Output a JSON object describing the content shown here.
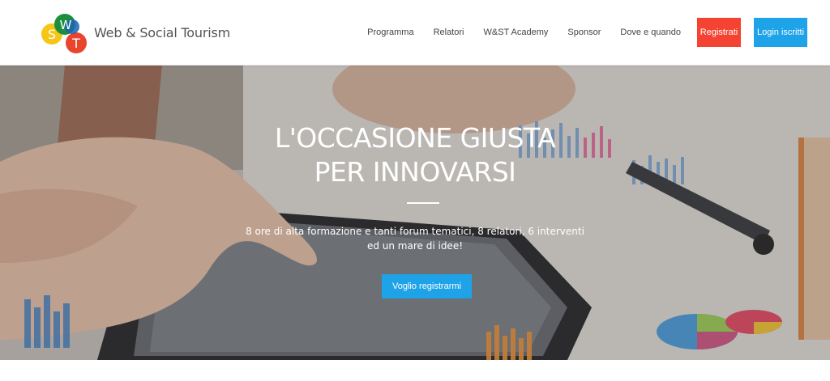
{
  "header": {
    "logo_letters": [
      "S",
      "W",
      "T"
    ],
    "brand": "Web & Social Tourism",
    "nav": [
      {
        "label": "Programma"
      },
      {
        "label": "Relatori"
      },
      {
        "label": "W&ST Academy"
      },
      {
        "label": "Sponsor"
      },
      {
        "label": "Dove e quando"
      }
    ],
    "register_label": "Registrati",
    "login_label": "Login iscritti"
  },
  "hero": {
    "title_line1": "L'OCCASIONE GIUSTA",
    "title_line2": "PER INNOVARSI",
    "subtitle_line1": "8 ore di alta formazione e tanti forum tematici, 8 relatori, 6 interventi",
    "subtitle_line2": "ed un mare di idee!",
    "cta_label": "Voglio registrarmi",
    "background_icon": "tablet-hand-photo-icon"
  },
  "colors": {
    "accent_red": "#f44332",
    "accent_blue": "#1fa3e8",
    "logo_yellow": "#f5c518",
    "logo_green": "#1c8f3c",
    "logo_blue": "#1a64b5",
    "logo_red": "#e8452c"
  }
}
